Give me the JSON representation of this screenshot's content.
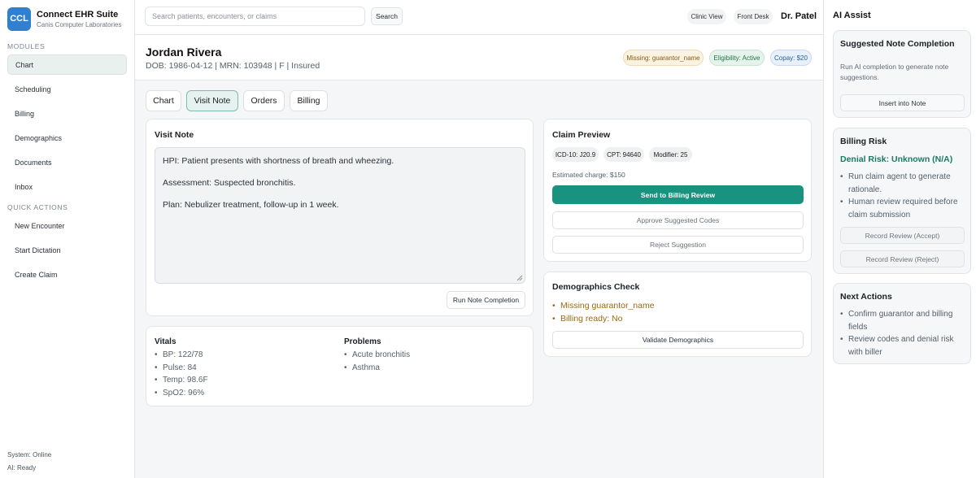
{
  "brand": {
    "logo": "CCL",
    "title": "Connect EHR Suite",
    "subtitle": "Canis Computer Laboratories"
  },
  "sidebar": {
    "modules_label": "MODULES",
    "modules": [
      "Chart",
      "Scheduling",
      "Billing",
      "Demographics",
      "Documents",
      "Inbox"
    ],
    "quick_label": "QUICK ACTIONS",
    "quick_actions": [
      "New Encounter",
      "Start Dictation",
      "Create Claim"
    ],
    "system_status": "System: Online",
    "ai_status": "AI: Ready"
  },
  "topbar": {
    "search_placeholder": "Search patients, encounters, or claims",
    "search_button": "Search",
    "clinic_view": "Clinic View",
    "front_desk": "Front Desk",
    "user": "Dr. Patel"
  },
  "patient": {
    "name": "Jordan Rivera",
    "info": "DOB: 1986-04-12 | MRN: 103948 | F | Insured",
    "badge_missing": "Missing: guarantor_name",
    "badge_eligibility": "Eligibility: Active",
    "badge_copay": "Copay: $20"
  },
  "tabs": [
    "Chart",
    "Visit Note",
    "Orders",
    "Billing"
  ],
  "visit_note": {
    "title": "Visit Note",
    "hpi": "HPI: Patient presents with shortness of breath and wheezing.",
    "assessment": "Assessment: Suspected bronchitis.",
    "plan": "Plan: Nebulizer treatment, follow-up in 1 week.",
    "run_button": "Run Note Completion"
  },
  "vitals": {
    "title": "Vitals",
    "items": [
      "BP: 122/78",
      "Pulse: 84",
      "Temp: 98.6F",
      "SpO2: 96%"
    ]
  },
  "problems": {
    "title": "Problems",
    "items": [
      "Acute bronchitis",
      "Asthma"
    ]
  },
  "claim": {
    "title": "Claim Preview",
    "icd": "ICD-10: J20.9",
    "cpt": "CPT: 94640",
    "modifier": "Modifier: 25",
    "estimate": "Estimated charge: $150",
    "send_button": "Send to Billing Review",
    "approve_button": "Approve Suggested Codes",
    "reject_button": "Reject Suggestion"
  },
  "demographics": {
    "title": "Demographics Check",
    "items": [
      "Missing guarantor_name",
      "Billing ready: No"
    ],
    "validate_button": "Validate Demographics"
  },
  "ai": {
    "title": "AI Assist",
    "suggest": {
      "title": "Suggested Note Completion",
      "text": "Run AI completion to generate note suggestions.",
      "insert_button": "Insert into Note"
    },
    "billing_risk": {
      "title": "Billing Risk",
      "risk": "Denial Risk: Unknown (N/A)",
      "items": [
        "Run claim agent to generate rationale.",
        "Human review required before claim submission"
      ],
      "accept_button": "Record Review (Accept)",
      "reject_button": "Record Review (Reject)"
    },
    "next": {
      "title": "Next Actions",
      "items": [
        "Confirm guarantor and billing fields",
        "Review codes and denial risk with biller"
      ]
    }
  }
}
